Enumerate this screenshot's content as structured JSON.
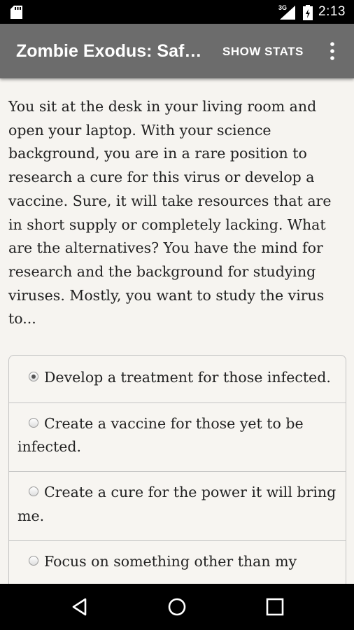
{
  "status_bar": {
    "network": "3G",
    "time": "2:13",
    "icons": [
      "sd-card-icon",
      "signal-icon",
      "battery-icon"
    ]
  },
  "app_bar": {
    "title": "Zombie Exodus: Safe Haven",
    "action": "SHOW STATS",
    "overflow_icon": "overflow-menu-icon",
    "background": "#6c6c6c"
  },
  "story": {
    "text": "You sit at the desk in your living room and open your laptop. With your science background, you are in a rare position to research a cure for this virus or develop a vaccine. Sure, it will take resources that are in short supply or completely lacking. What are the alternatives? You have the mind for research and the background for studying viruses. Mostly, you want to study the virus to..."
  },
  "choices": [
    {
      "label": "Develop a treatment for those infected.",
      "selected": true
    },
    {
      "label": "Create a vaccine for those yet to be infected.",
      "selected": false
    },
    {
      "label": "Create a cure for the power it will bring me.",
      "selected": false
    },
    {
      "label": "Focus on something other than my",
      "selected": false
    }
  ],
  "nav_bar": {
    "icons": [
      "back-icon",
      "home-icon",
      "recent-apps-icon"
    ]
  }
}
